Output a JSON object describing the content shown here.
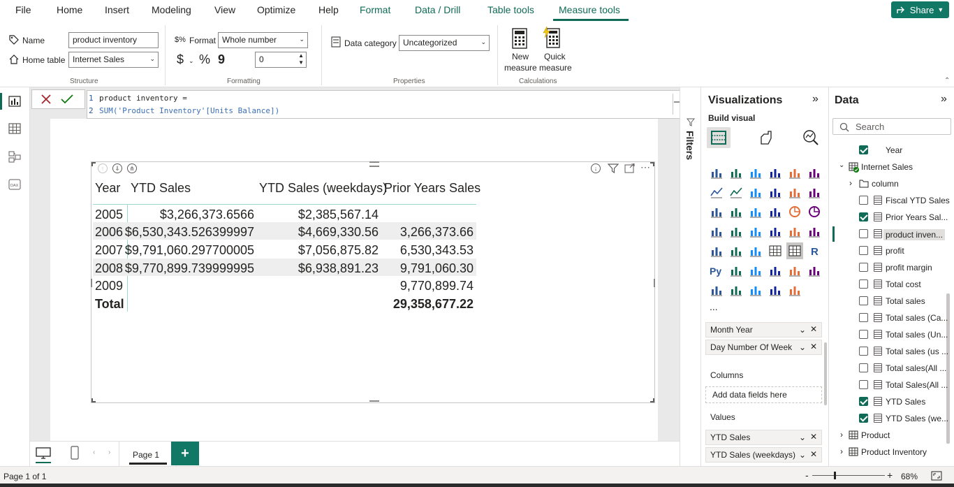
{
  "menu": {
    "file": "File",
    "home": "Home",
    "insert": "Insert",
    "modeling": "Modeling",
    "view": "View",
    "optimize": "Optimize",
    "help": "Help",
    "format": "Format",
    "data_drill": "Data / Drill",
    "table_tools": "Table tools",
    "measure_tools": "Measure tools",
    "share": "Share"
  },
  "ribbon": {
    "name_label": "Name",
    "name_value": "product inventory",
    "home_table_label": "Home table",
    "home_table_value": "Internet Sales",
    "structure_label": "Structure",
    "format_label": "Format",
    "format_value": "Whole number",
    "currency_symbol": "$",
    "percent_symbol": "%",
    "comma_symbol": "9",
    "decimals_value": "0",
    "formatting_label": "Formatting",
    "data_category_label": "Data category",
    "data_category_value": "Uncategorized",
    "properties_label": "Properties",
    "new_measure_label_1": "New",
    "new_measure_label_2": "measure",
    "quick_measure_label_1": "Quick",
    "quick_measure_label_2": "measure",
    "calculations_label": "Calculations"
  },
  "formula": {
    "line1_num": "1",
    "line1": "product inventory =",
    "line2_num": "2",
    "line2": "SUM('Product Inventory'[Units Balance])"
  },
  "table": {
    "headers": [
      "Year",
      "YTD Sales",
      "YTD Sales (weekdays)",
      "Prior Years Sales"
    ],
    "rows": [
      [
        "2005",
        "$3,266,373.6566",
        "$2,385,567.14",
        ""
      ],
      [
        "2006",
        "$6,530,343.526399997",
        "$4,669,330.56",
        "3,266,373.66"
      ],
      [
        "2007",
        "$9,791,060.297700005",
        "$7,056,875.82",
        "6,530,343.53"
      ],
      [
        "2008",
        "$9,770,899.739999995",
        "$6,938,891.23",
        "9,791,060.30"
      ],
      [
        "2009",
        "",
        "",
        "9,770,899.74"
      ]
    ],
    "total": [
      "Total",
      "",
      "",
      "29,358,677.22"
    ]
  },
  "filters": {
    "label": "Filters"
  },
  "viz": {
    "title": "Visualizations",
    "build_visual": "Build visual",
    "rows_fields": [
      "Month Year",
      "Day Number Of Week"
    ],
    "columns_label": "Columns",
    "columns_placeholder": "Add data fields here",
    "values_label": "Values",
    "values_fields": [
      "YTD Sales",
      "YTD Sales (weekdays)"
    ],
    "more": "..."
  },
  "data_pane": {
    "title": "Data",
    "search_placeholder": "Search",
    "year": "Year",
    "internet_sales": "Internet Sales",
    "column": "column",
    "fields": [
      {
        "label": "Fiscal YTD Sales",
        "checked": false
      },
      {
        "label": "Prior Years Sal...",
        "checked": true
      },
      {
        "label": "product inven...",
        "checked": false
      },
      {
        "label": "profit",
        "checked": false
      },
      {
        "label": "profit margin",
        "checked": false
      },
      {
        "label": "Total cost",
        "checked": false
      },
      {
        "label": "Total sales",
        "checked": false
      },
      {
        "label": "Total sales (Ca...",
        "checked": false
      },
      {
        "label": "Total sales (Un...",
        "checked": false
      },
      {
        "label": "Total sales (us ...",
        "checked": false
      },
      {
        "label": "Total sales(All ...",
        "checked": false
      },
      {
        "label": "Total Sales(All ...",
        "checked": false
      },
      {
        "label": "YTD Sales",
        "checked": true
      },
      {
        "label": "YTD Sales (we...",
        "checked": true
      }
    ],
    "product": "Product",
    "product_inventory": "Product Inventory"
  },
  "bottom": {
    "page_tab": "Page 1",
    "add_page": "+",
    "status": "Page 1 of 1",
    "zoom": "68%",
    "zoom_minus": "-",
    "zoom_plus": "+"
  },
  "colors": {
    "accent": "#106b56",
    "share_bg": "#117865",
    "cancel": "#a4262c"
  }
}
